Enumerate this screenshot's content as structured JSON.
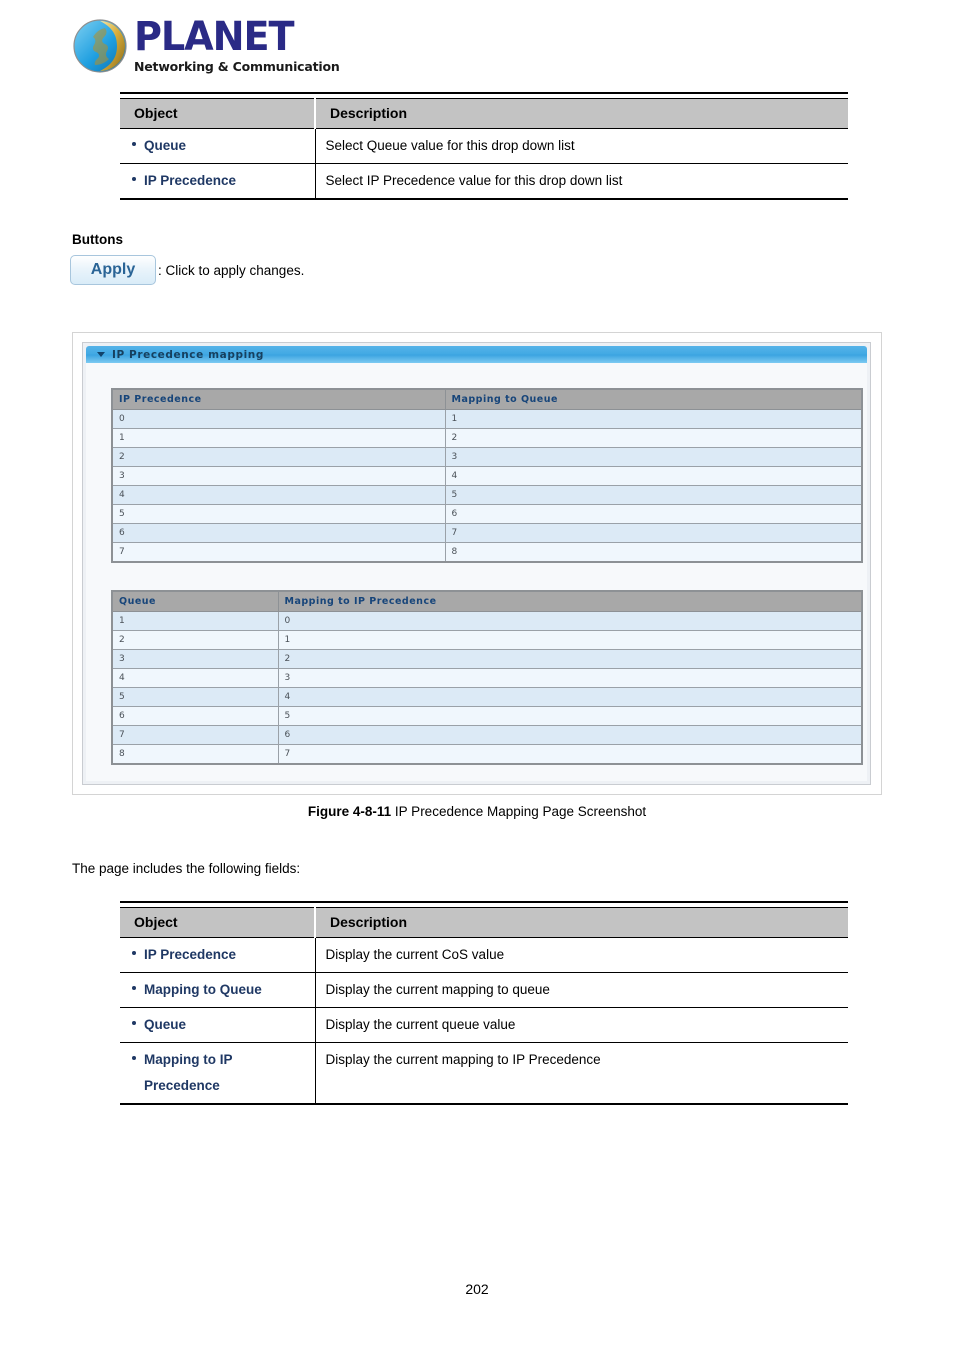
{
  "brand": {
    "name": "PLANET",
    "tagline": "Networking & Communication"
  },
  "table_top": {
    "headers": [
      "Object",
      "Description"
    ],
    "rows": [
      {
        "object": "Queue",
        "object_line2": "",
        "description": "Select Queue value for this drop down list"
      },
      {
        "object": "IP Precedence",
        "object_line2": "",
        "description": "Select IP Precedence value for this drop down list"
      }
    ]
  },
  "buttons_section": {
    "heading": "Buttons",
    "apply_label": "Apply",
    "apply_caption": ": Click to apply changes."
  },
  "screenshot_panel": {
    "title": "IP Precedence mapping",
    "table1": {
      "headers": [
        "IP Precedence",
        "Mapping to Queue"
      ],
      "rows": [
        [
          "0",
          "1"
        ],
        [
          "1",
          "2"
        ],
        [
          "2",
          "3"
        ],
        [
          "3",
          "4"
        ],
        [
          "4",
          "5"
        ],
        [
          "5",
          "6"
        ],
        [
          "6",
          "7"
        ],
        [
          "7",
          "8"
        ]
      ]
    },
    "table2": {
      "headers": [
        "Queue",
        "Mapping to IP Precedence"
      ],
      "rows": [
        [
          "1",
          "0"
        ],
        [
          "2",
          "1"
        ],
        [
          "3",
          "2"
        ],
        [
          "4",
          "3"
        ],
        [
          "5",
          "4"
        ],
        [
          "6",
          "5"
        ],
        [
          "7",
          "6"
        ],
        [
          "8",
          "7"
        ]
      ]
    }
  },
  "figure_caption": {
    "label": "Figure 4-8-11",
    "text": " IP Precedence Mapping Page Screenshot"
  },
  "intro_text": "The page includes the following fields:",
  "table_bottom": {
    "headers": [
      "Object",
      "Description"
    ],
    "rows": [
      {
        "object": "IP Precedence",
        "object_line2": "",
        "description": "Display the current CoS value"
      },
      {
        "object": "Mapping to Queue",
        "object_line2": "",
        "description": "Display the current mapping to queue"
      },
      {
        "object": "Queue",
        "object_line2": "",
        "description": "Display the current queue value"
      },
      {
        "object": "Mapping to IP",
        "object_line2": "Precedence",
        "description": "Display the current mapping to IP Precedence"
      }
    ]
  },
  "page_number": "202"
}
